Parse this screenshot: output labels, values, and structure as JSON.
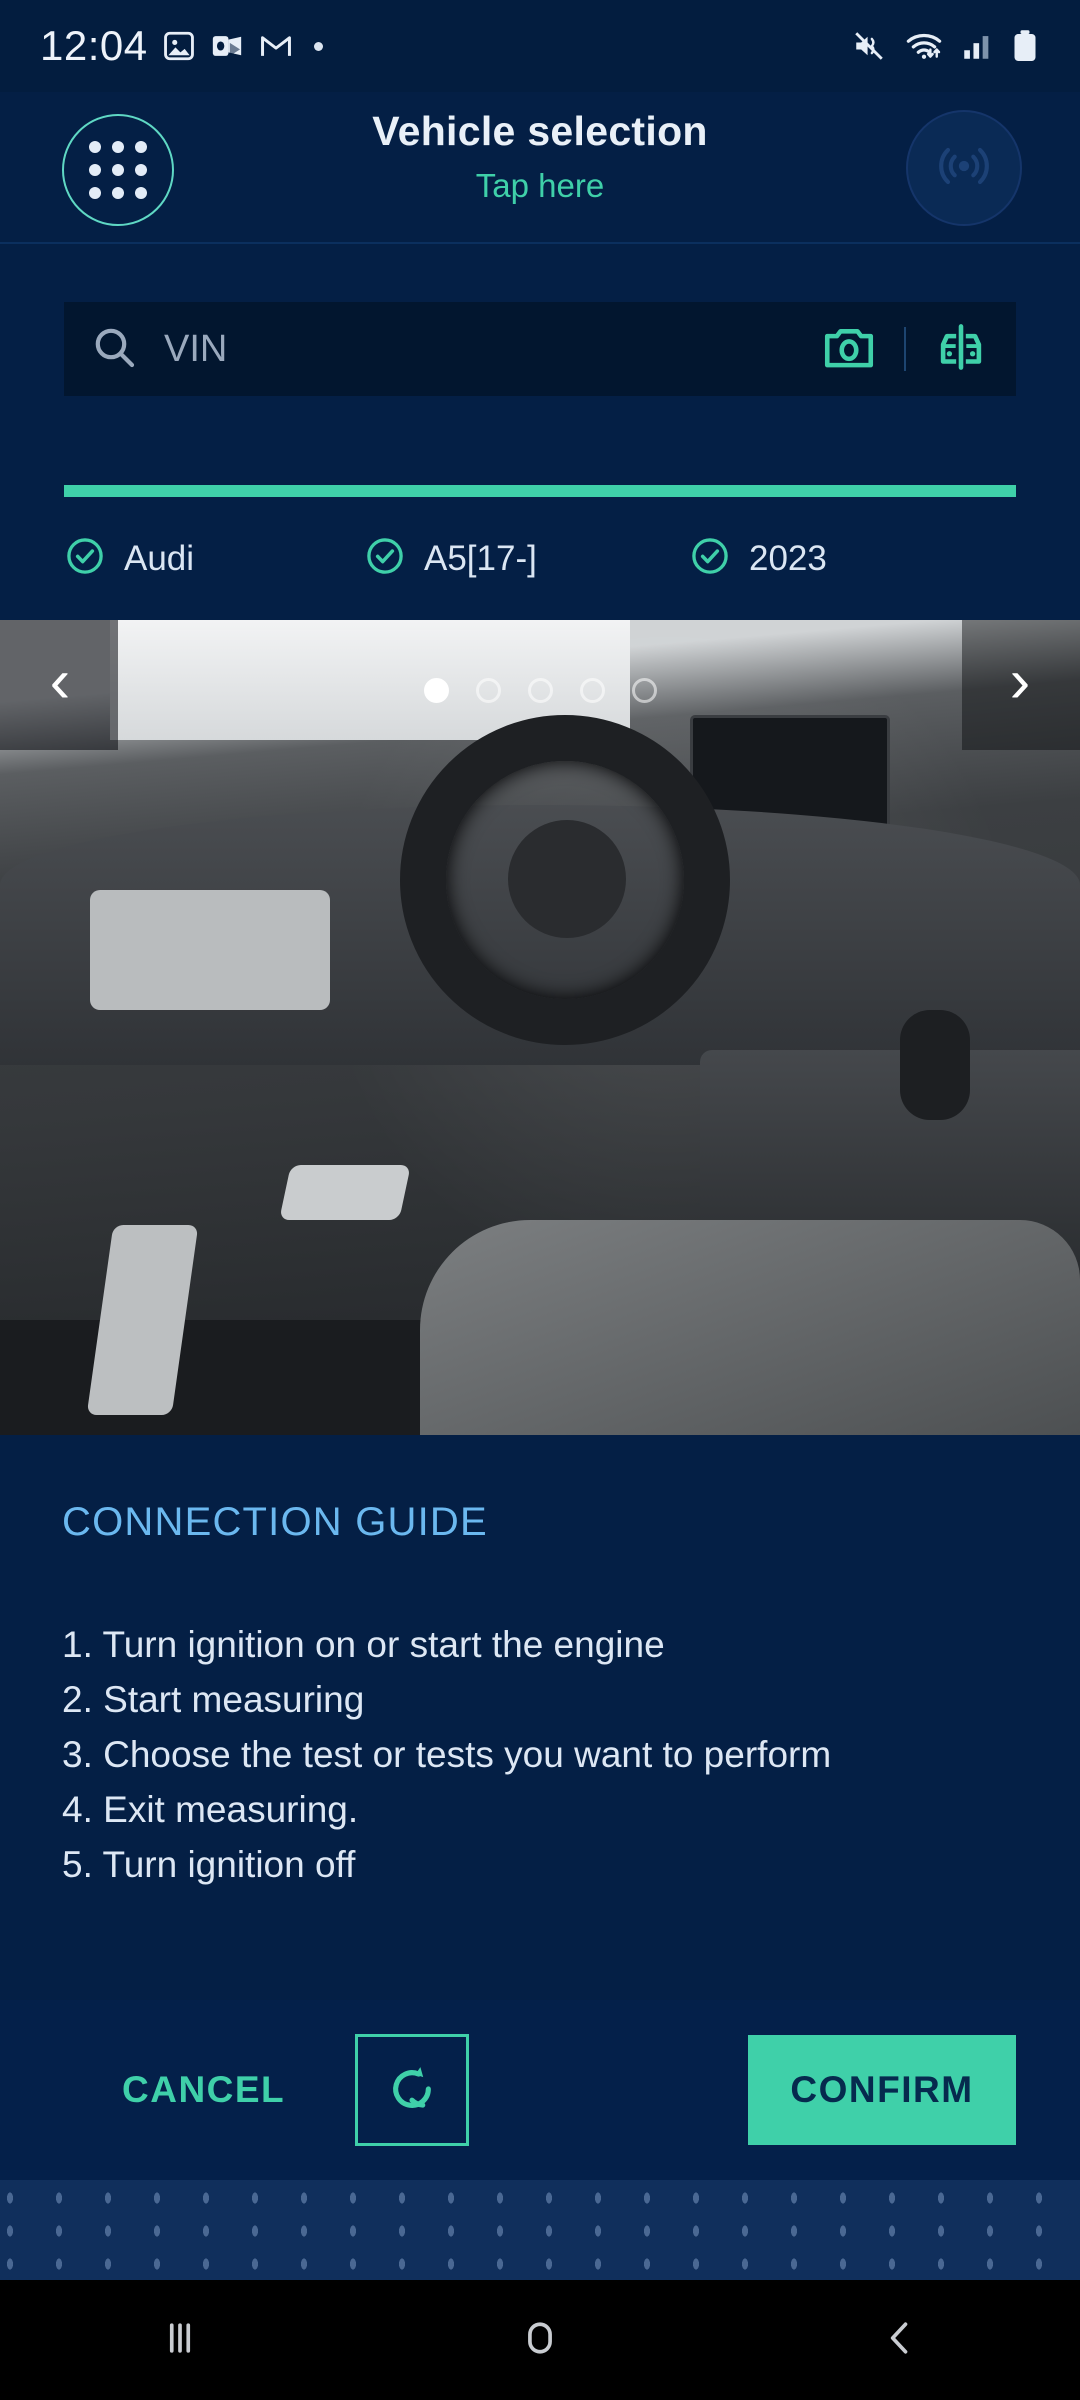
{
  "status_bar": {
    "time": "12:04",
    "left_icons": [
      "photos-icon",
      "outlook-icon",
      "gmail-icon",
      "more-notifications-dot"
    ],
    "right_icons": [
      "mute-vibrate-icon",
      "wifi-icon",
      "cellular-signal-icon",
      "battery-icon"
    ]
  },
  "header": {
    "menu_icon": "app-grid-icon",
    "title": "Vehicle selection",
    "subtitle": "Tap here",
    "connect_icon": "wireless-broadcast-icon"
  },
  "search": {
    "placeholder": "VIN",
    "value": "",
    "search_icon": "search-icon",
    "camera_icon": "camera-icon",
    "compare_icon": "vehicle-compare-icon"
  },
  "progress": {
    "percent": 100,
    "fill_color": "#3fd0a9"
  },
  "steps": [
    {
      "label": "Audi",
      "checked": true
    },
    {
      "label": "A5[17-]",
      "checked": true
    },
    {
      "label": "2023",
      "checked": true
    }
  ],
  "carousel": {
    "prev_icon": "chevron-left-icon",
    "next_icon": "chevron-right-icon",
    "total_slides": 5,
    "active_slide": 1,
    "image_alt": "audi-a5-interior-dashboard-photo"
  },
  "guide": {
    "title": "CONNECTION GUIDE",
    "steps": [
      "1. Turn ignition on or start the engine",
      "2. Start measuring",
      "3. Choose the test or tests you want to perform",
      "4. Exit measuring.",
      "5. Turn ignition off"
    ]
  },
  "actions": {
    "cancel_label": "CANCEL",
    "refresh_icon": "refresh-icon",
    "confirm_label": "CONFIRM"
  },
  "nav_bar": {
    "recents_icon": "recents-icon",
    "home_icon": "home-icon",
    "back_icon": "back-icon"
  },
  "colors": {
    "background": "#041f45",
    "accent_teal": "#3fd0a9",
    "title_blue": "#6bb8ef",
    "field_background": "#02162f"
  }
}
